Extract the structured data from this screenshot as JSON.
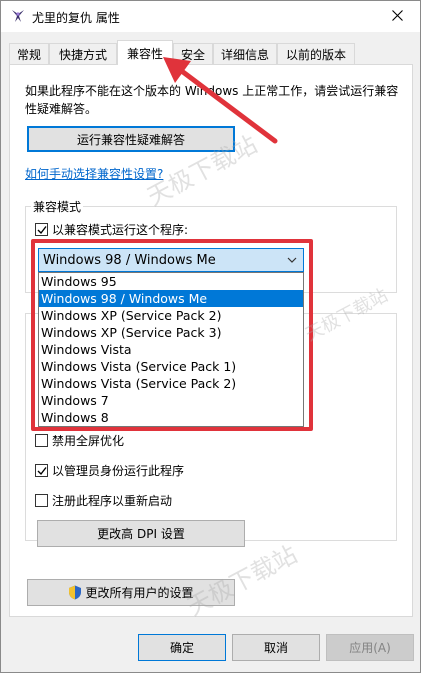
{
  "window": {
    "title": "尤里的复仇 属性",
    "app_icon": "yuri-app-icon",
    "close_icon": "close-icon"
  },
  "tabs": [
    {
      "label": "常规",
      "active": false
    },
    {
      "label": "快捷方式",
      "active": false
    },
    {
      "label": "兼容性",
      "active": true
    },
    {
      "label": "安全",
      "active": false
    },
    {
      "label": "详细信息",
      "active": false
    },
    {
      "label": "以前的版本",
      "active": false
    }
  ],
  "compat": {
    "description": "如果此程序不能在这个版本的 Windows 上正常工作，请尝试运行兼容性疑难解答。",
    "troubleshoot_button": "运行兼容性疑难解答",
    "manual_link": "如何手动选择兼容性设置?",
    "mode_group_label": "兼容模式",
    "run_in_compat_mode": {
      "label": "以兼容模式运行这个程序:",
      "checked": true
    },
    "selected_os": "Windows 98 / Windows Me",
    "os_options": [
      "Windows 95",
      "Windows 98 / Windows Me",
      "Windows XP (Service Pack 2)",
      "Windows XP (Service Pack 3)",
      "Windows Vista",
      "Windows Vista (Service Pack 1)",
      "Windows Vista (Service Pack 2)",
      "Windows 7",
      "Windows 8"
    ],
    "selected_index": 1
  },
  "settings": {
    "disable_fullscreen_opt": {
      "label": "禁用全屏优化",
      "checked": false
    },
    "run_as_admin": {
      "label": "以管理员身份运行此程序",
      "checked": true
    },
    "register_restart": {
      "label": "注册此程序以重新启动",
      "checked": false
    },
    "dpi_button": "更改高 DPI 设置"
  },
  "all_users_button": "更改所有用户的设置",
  "footer": {
    "ok": "确定",
    "cancel": "取消",
    "apply": "应用(A)"
  },
  "watermarks": [
    "天极下载站",
    "天极下载站",
    "天极下载站"
  ],
  "colors": {
    "accent": "#0078d7",
    "highlight_box": "#e0333b",
    "link": "#0066cc"
  }
}
